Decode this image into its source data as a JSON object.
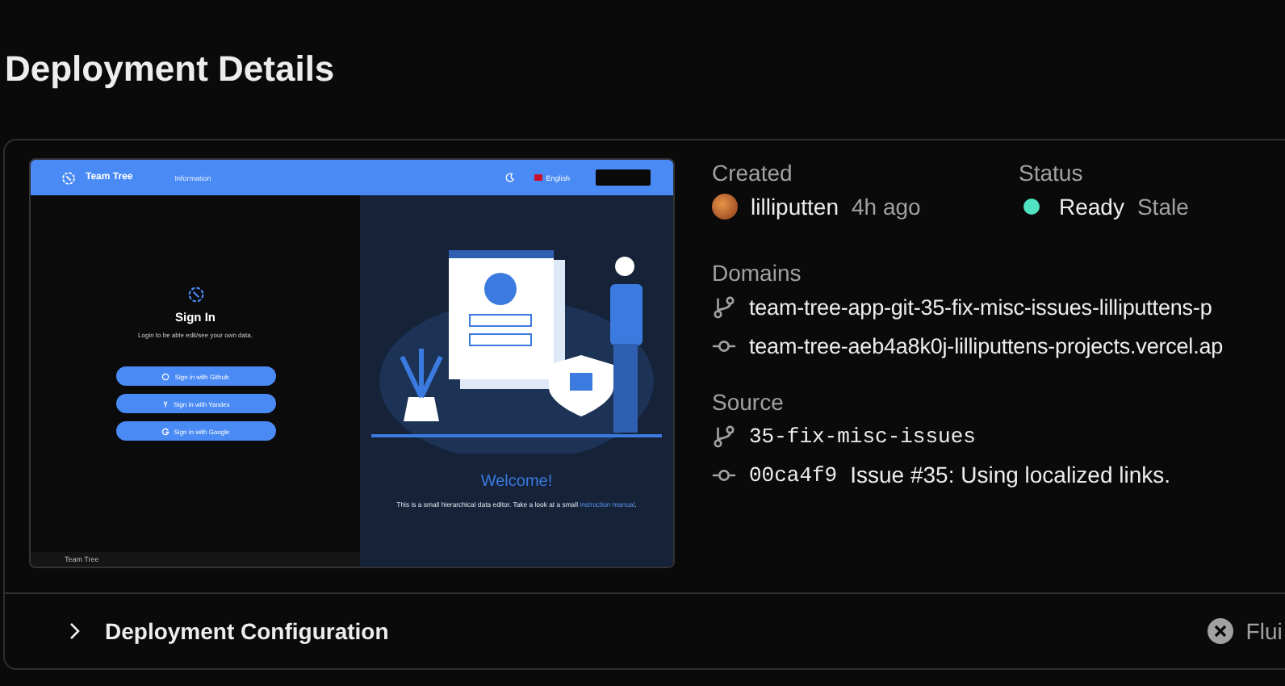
{
  "title": "Deployment Details",
  "preview": {
    "header": {
      "brand": "Team Tree",
      "nav": "Information",
      "language": "English"
    },
    "sign_in": {
      "title": "Sign In",
      "subtitle": "Login to be able edit/see your own data.",
      "buttons": [
        {
          "kind": "github",
          "label": "Sign in with Github"
        },
        {
          "kind": "yandex",
          "label": "Sign in with Yandex"
        },
        {
          "kind": "google",
          "label": "Sign in with Google"
        }
      ]
    },
    "footer": "Team Tree",
    "welcome": {
      "title": "Welcome!",
      "text": "This is a small hierarchical data editor. Take a look at a small ",
      "link": "instruction manual",
      "end": "."
    }
  },
  "created": {
    "label": "Created",
    "user": "lilliputten",
    "time": "4h ago"
  },
  "status": {
    "label": "Status",
    "value": "Ready",
    "color": "#50e3c2",
    "note": "Stale"
  },
  "domains": {
    "label": "Domains",
    "items": [
      {
        "kind": "branch",
        "text": "team-tree-app-git-35-fix-misc-issues-lilliputtens-p"
      },
      {
        "kind": "commit",
        "text": "team-tree-aeb4a8k0j-lilliputtens-projects.vercel.ap"
      }
    ]
  },
  "source": {
    "label": "Source",
    "branch": "35-fix-misc-issues",
    "commit": "00ca4f9",
    "message": "Issue #35: Using localized links."
  },
  "configuration": {
    "title": "Deployment Configuration",
    "expanded": false,
    "badge": "Flui"
  }
}
